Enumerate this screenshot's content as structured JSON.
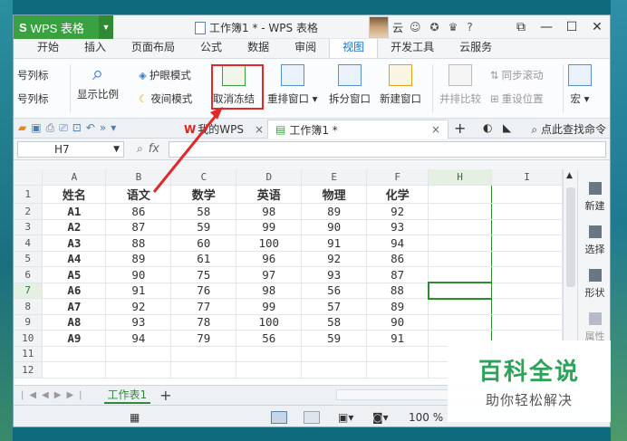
{
  "app": {
    "name": "WPS 表格",
    "window_title": "工作簿1 * - WPS 表格",
    "user_label": "云"
  },
  "menu_tabs": [
    "开始",
    "插入",
    "页面布局",
    "公式",
    "数据",
    "审阅",
    "视图",
    "开发工具",
    "云服务"
  ],
  "active_menu_tab": "视图",
  "ribbon": {
    "row_col_title_1": "号列标",
    "row_col_title_2": "号列标",
    "display_ratio": "显示比例",
    "eye_protection": "护眼模式",
    "night_mode": "夜间模式",
    "unfreeze": "取消冻结",
    "rearrange_window": "重排窗口",
    "split_window": "拆分窗口",
    "new_window": "新建窗口",
    "side_by_side": "并排比较",
    "sync_scroll": "同步滚动",
    "reset_position": "重设位置",
    "macro": "宏"
  },
  "doc_tabs": {
    "wps_tab": "我的WPS",
    "workbook_tab": "工作簿1 *",
    "find_command": "点此查找命令"
  },
  "formula_bar": {
    "cell_ref": "H7",
    "fx": "fx",
    "formula": ""
  },
  "grid": {
    "columns": [
      "A",
      "B",
      "C",
      "D",
      "E",
      "F",
      "H",
      "I"
    ],
    "selected_column": "H",
    "selected_row": "7",
    "header_row": [
      "姓名",
      "语文",
      "数学",
      "英语",
      "物理",
      "化学"
    ],
    "rows": [
      [
        "A1",
        "86",
        "58",
        "98",
        "89",
        "92"
      ],
      [
        "A2",
        "87",
        "59",
        "99",
        "90",
        "93"
      ],
      [
        "A3",
        "88",
        "60",
        "100",
        "91",
        "94"
      ],
      [
        "A4",
        "89",
        "61",
        "96",
        "92",
        "86"
      ],
      [
        "A5",
        "90",
        "75",
        "97",
        "93",
        "87"
      ],
      [
        "A6",
        "91",
        "76",
        "98",
        "56",
        "88"
      ],
      [
        "A7",
        "92",
        "77",
        "99",
        "57",
        "89"
      ],
      [
        "A8",
        "93",
        "78",
        "100",
        "58",
        "90"
      ],
      [
        "A9",
        "94",
        "79",
        "56",
        "59",
        "91"
      ],
      [
        "",
        "",
        "",
        "",
        "",
        ""
      ],
      [
        "",
        "",
        "",
        "",
        "",
        ""
      ]
    ],
    "row_numbers": [
      "1",
      "2",
      "3",
      "4",
      "5",
      "6",
      "7",
      "8",
      "9",
      "10",
      "11",
      "12"
    ]
  },
  "taskpane": {
    "new": "新建",
    "select": "选择",
    "shape": "形状",
    "property": "属性"
  },
  "sheet_tabs": {
    "sheet1": "工作表1",
    "add": "+"
  },
  "status_bar": {
    "zoom": "100 %"
  },
  "watermark": {
    "title": "百科全说",
    "subtitle": "助你轻松解决"
  }
}
